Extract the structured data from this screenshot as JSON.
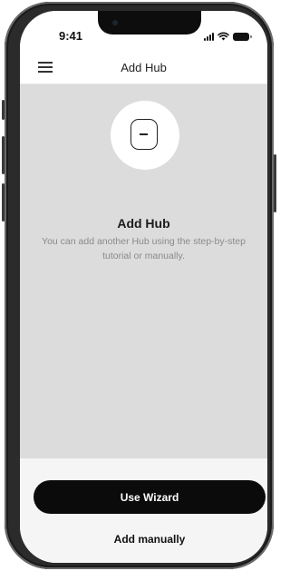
{
  "status_bar": {
    "time": "9:41",
    "signal_icon": "cellular-signal-icon",
    "wifi_icon": "wifi-icon",
    "battery_icon": "battery-icon"
  },
  "nav": {
    "menu_icon": "hamburger-menu-icon",
    "title": "Add Hub"
  },
  "content": {
    "hub_icon": "hub-device-icon",
    "title": "Add Hub",
    "description": "You can add another Hub using the step-by-step tutorial or manually."
  },
  "actions": {
    "wizard_label": "Use Wizard",
    "manual_label": "Add manually"
  },
  "colors": {
    "content_background": "#dcdcdc",
    "primary_button": "#0b0b0b",
    "primary_button_text": "#ffffff",
    "description_text": "#8a8a8a"
  }
}
